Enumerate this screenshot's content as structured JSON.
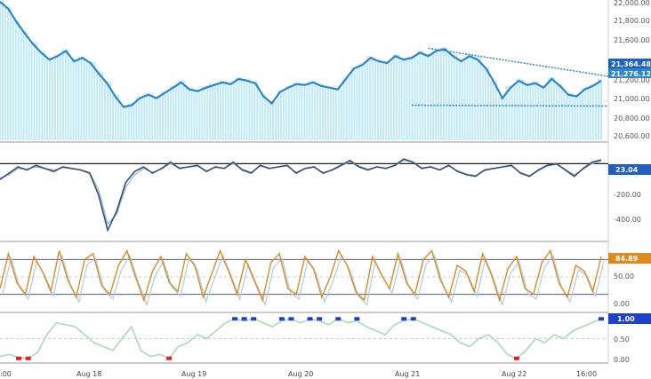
{
  "colors": {
    "price_fill": "#bfe9f5",
    "price_line": "#2e86c9",
    "price_trend": "#2e86c9",
    "macd_main": "#3b4f6b",
    "macd_signal": "#8fb6e0",
    "macd_zero": "#222222",
    "stoch_main": "#e08a1e",
    "stoch_signal": "#a9cde8",
    "stoch_bounds": "#5a5a8a",
    "ind_green": "#a8dcb4",
    "ind_blue": "#1f3fd6",
    "ind_red": "#e02020",
    "badge_blue": "#1f5fbf",
    "badge_price2": "#2e86c9",
    "badge_orange": "#e08a1e",
    "badge_ind": "#2040d0",
    "separator": "#888888"
  },
  "x_axis": {
    "labels": [
      ":00",
      "Aug 18",
      "Aug 19",
      "Aug 20",
      "Aug 21",
      "Aug 22",
      "16:00"
    ]
  },
  "price_axis": {
    "ticks": [
      "22,000.00",
      "21,800.00",
      "21,600.00",
      "21,400.00",
      "21,200.00",
      "21,000.00",
      "20,800.00",
      "20,600.00"
    ]
  },
  "badges": {
    "price_1": "21,364.48",
    "price_2": "21,276.12",
    "macd": "23.04",
    "stoch": "84.89",
    "ind": "1.00"
  },
  "macd_axis": {
    "ticks": [
      "0.00",
      "-200.00",
      "-400.00"
    ]
  },
  "stoch_axis": {
    "ticks": [
      "50.00",
      "0.00"
    ]
  },
  "ind_axis": {
    "ticks": [
      "0.50",
      "0.00"
    ]
  },
  "chart_data": [
    {
      "type": "area",
      "panel": "price",
      "ylim": [
        20600,
        22200
      ],
      "series": [
        {
          "values": [
            22180,
            22100,
            21950,
            21820,
            21700,
            21600,
            21520,
            21560,
            21620,
            21500,
            21540,
            21480,
            21360,
            21250,
            21100,
            20980,
            21000,
            21080,
            21120,
            21080,
            21140,
            21200,
            21260,
            21180,
            21160,
            21200,
            21230,
            21260,
            21240,
            21300,
            21280,
            21250,
            21100,
            21020,
            21150,
            21200,
            21240,
            21230,
            21260,
            21220,
            21200,
            21180,
            21300,
            21420,
            21460,
            21540,
            21500,
            21480,
            21560,
            21520,
            21540,
            21600,
            21560,
            21620,
            21640,
            21560,
            21500,
            21560,
            21520,
            21420,
            21260,
            21080,
            21200,
            21280,
            21230,
            21250,
            21200,
            21300,
            21220,
            21120,
            21100,
            21180,
            21220,
            21280
          ]
        }
      ],
      "annotations": [
        {
          "kind": "trendline",
          "from": [
            52,
            21650
          ],
          "to": [
            73,
            21330
          ]
        },
        {
          "kind": "support",
          "from": [
            50,
            21000
          ],
          "to": [
            73,
            20990
          ]
        }
      ]
    },
    {
      "type": "line",
      "panel": "macd",
      "ylim": [
        -480,
        120
      ],
      "series": [
        {
          "values": [
            -100,
            -60,
            -20,
            -40,
            -10,
            -30,
            -50,
            -20,
            -30,
            -40,
            -60,
            -200,
            -420,
            -300,
            -120,
            -50,
            -20,
            -60,
            -30,
            10,
            -30,
            -20,
            -10,
            -50,
            -20,
            -30,
            10,
            -40,
            -60,
            -10,
            -30,
            -20,
            -10,
            -60,
            -30,
            -20,
            -60,
            -40,
            -10,
            20,
            -20,
            -40,
            -20,
            -30,
            -10,
            30,
            10,
            -30,
            -20,
            -40,
            -10,
            -50,
            -70,
            -80,
            -40,
            -30,
            -20,
            -10,
            -60,
            -80,
            -40,
            -10,
            0,
            -40,
            -80,
            -30,
            10,
            23
          ],
          "color_key": "macd_main"
        },
        {
          "values": [
            -90,
            -70,
            -30,
            -35,
            -20,
            -30,
            -40,
            -25,
            -30,
            -38,
            -55,
            -170,
            -380,
            -320,
            -150,
            -70,
            -30,
            -55,
            -35,
            0,
            -25,
            -22,
            -15,
            -45,
            -25,
            -28,
            0,
            -35,
            -55,
            -15,
            -28,
            -22,
            -15,
            -55,
            -32,
            -22,
            -55,
            -42,
            -15,
            10,
            -15,
            -35,
            -22,
            -28,
            -15,
            20,
            10,
            -25,
            -22,
            -38,
            -15,
            -45,
            -65,
            -75,
            -45,
            -32,
            -22,
            -15,
            -55,
            -75,
            -45,
            -15,
            -5,
            -35,
            -70,
            -35,
            0,
            18
          ],
          "color_key": "macd_signal"
        }
      ]
    },
    {
      "type": "line",
      "panel": "stochastic",
      "ylim": [
        -5,
        105
      ],
      "series": [
        {
          "values": [
            30,
            90,
            40,
            20,
            85,
            60,
            25,
            95,
            45,
            15,
            80,
            90,
            35,
            20,
            70,
            95,
            50,
            10,
            60,
            85,
            40,
            25,
            90,
            70,
            15,
            55,
            95,
            60,
            20,
            80,
            45,
            10,
            75,
            90,
            30,
            20,
            85,
            65,
            15,
            50,
            95,
            70,
            25,
            10,
            85,
            55,
            30,
            90,
            40,
            20,
            80,
            95,
            45,
            15,
            70,
            60,
            25,
            90,
            55,
            10,
            65,
            85,
            30,
            20,
            75,
            95,
            40,
            15,
            70,
            60,
            25,
            85
          ],
          "color_key": "stoch_main"
        }
      ],
      "bands": [
        80,
        20
      ]
    },
    {
      "type": "area",
      "panel": "indicator",
      "ylim": [
        -0.05,
        1.05
      ],
      "series": [
        {
          "values": [
            0.05,
            0.1,
            0.02,
            0.0,
            0.15,
            0.6,
            0.9,
            0.85,
            0.8,
            0.6,
            0.4,
            0.3,
            0.2,
            0.5,
            0.8,
            0.2,
            0.05,
            0.1,
            0.0,
            0.3,
            0.4,
            0.6,
            0.5,
            0.7,
            0.9,
            1.0,
            0.95,
            1.0,
            0.9,
            0.8,
            0.95,
            1.0,
            0.9,
            1.0,
            0.95,
            0.85,
            1.0,
            0.9,
            0.95,
            0.8,
            0.7,
            0.6,
            0.85,
            0.95,
            1.0,
            0.9,
            0.8,
            0.7,
            0.6,
            0.4,
            0.3,
            0.5,
            0.6,
            0.4,
            0.1,
            0.0,
            0.2,
            0.5,
            0.4,
            0.6,
            0.5,
            0.7,
            0.8,
            0.9,
            1.0
          ],
          "color_key": "ind_green"
        }
      ]
    }
  ]
}
